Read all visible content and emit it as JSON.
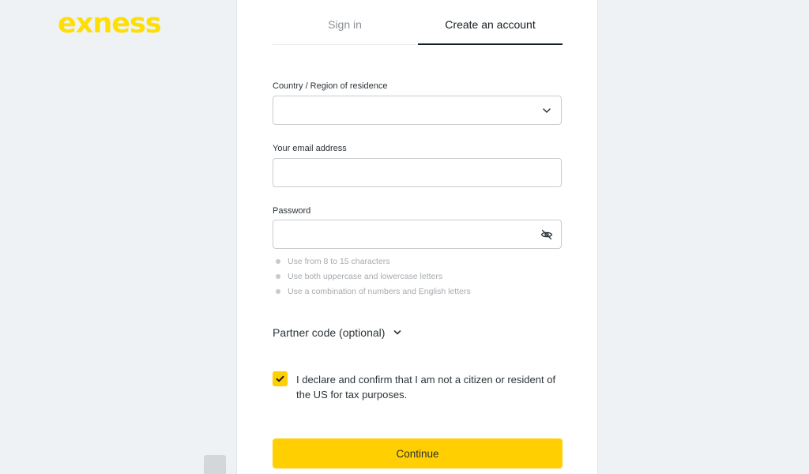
{
  "brand": {
    "logo_text": "exness",
    "accent_color": "#ffcf01",
    "logo_color": "#ffde02"
  },
  "tabs": [
    {
      "label": "Sign in",
      "active": false
    },
    {
      "label": "Create an account",
      "active": true
    }
  ],
  "form": {
    "country": {
      "label": "Country / Region of residence",
      "value": "",
      "icon": "chevron-down-icon"
    },
    "email": {
      "label": "Your email address",
      "value": ""
    },
    "password": {
      "label": "Password",
      "value": "",
      "icon": "eye-slash-icon"
    },
    "password_hints": [
      "Use from 8 to 15 characters",
      "Use both uppercase and lowercase letters",
      "Use a combination of numbers and English letters"
    ],
    "partner_code_label": "Partner code (optional)",
    "declaration": {
      "checked": true,
      "text": "I declare and confirm that I am not a citizen or resident of the US for tax purposes."
    },
    "submit_label": "Continue"
  }
}
